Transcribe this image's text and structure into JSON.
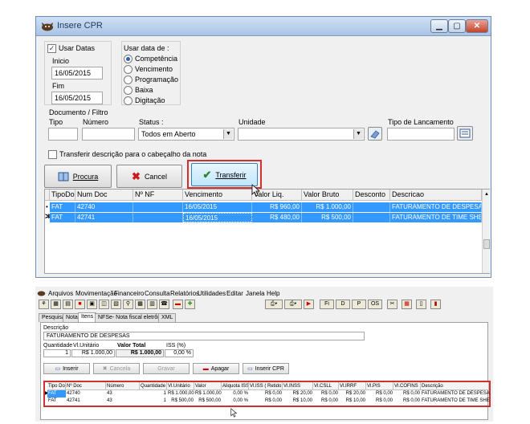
{
  "dialog": {
    "title": "Insere CPR",
    "usar_datas_label": "Usar Datas",
    "inicio_label": "Inicio",
    "inicio_value": "16/05/2015",
    "fim_label": "Fim",
    "fim_value": "16/05/2015",
    "usar_data_de_label": "Usar data de :",
    "radio_options": [
      "Competência",
      "Vencimento",
      "Programação",
      "Baixa",
      "Digitação"
    ],
    "documento_filtro_label": "Documento / Filtro",
    "tipo_label": "Tipo",
    "numero_label": "Número",
    "status_label": "Status :",
    "status_value": "Todos em Aberto",
    "unidade_label": "Unidade",
    "tipo_lancamento_label": "Tipo de Lancamento",
    "transferir_desc_label": "Transferir descrição para o cabeçalho da nota",
    "buttons": {
      "procura": "Procura",
      "cancel": "Cancel",
      "transferir": "Transferir"
    },
    "grid": {
      "headers": [
        "TipoDoc",
        "Num Doc",
        "Nº NF",
        "Vencimento",
        "Valor Liq.",
        "Valor Bruto",
        "Desconto",
        "Descricao"
      ],
      "rows": [
        [
          "FAT",
          "42740",
          "",
          "16/05/2015",
          "R$ 960,00",
          "R$ 1.000,00",
          "",
          "FATURAMENTO DE DESPESAS"
        ],
        [
          "FAT",
          "42741",
          "",
          "16/05/2015",
          "R$ 480,00",
          "R$ 500,00",
          "",
          "FATURAMENTO DE TIME SHEET"
        ]
      ]
    }
  },
  "app": {
    "menu": [
      "Arquivos",
      "Movimentação",
      "Financeiro",
      "Consulta",
      "Relatórios",
      "Utilidades",
      "Editar",
      "Janela",
      "Help"
    ],
    "tabs": [
      "Pesquisa",
      "Nota",
      "Itens",
      "NFSe- Nota fiscal eletrônica",
      "XML"
    ],
    "toolbar_labels": [
      "Fi",
      "D",
      "P",
      "OS"
    ],
    "descricao_label": "Descrição",
    "descricao_value": "FATURAMENTO DE DESPESAS",
    "quantidade_label": "Quantidade",
    "vl_unitario_label": "Vl.Unitário",
    "valor_total_label": "Valor Total",
    "iss_label": "ISS (%)",
    "quantidade_value": "1",
    "vl_unitario_value": "R$ 1.000,00",
    "valor_total_value": "R$ 1.000,00",
    "iss_value": "0,00 %",
    "buttons": {
      "inserir": "Inserir",
      "cancela": "Cancela",
      "gravar": "Gravar",
      "apagar": "Apagar",
      "inserir_cpr": "Inserir CPR"
    },
    "grid": {
      "headers": [
        "Tipo Doc",
        "Nº Doc",
        "Número",
        "Quantidade",
        "Vl.Unitário",
        "Valor",
        "Aliquota ISS",
        "Vl.ISS ( Retido )",
        "Vl.INSS",
        "Vl.CSLL",
        "Vl.IRRF",
        "Vl.PIS",
        "Vl.COFINS",
        "Descrição"
      ],
      "rows": [
        [
          "FAT",
          "42740",
          "43",
          "1",
          "R$ 1.000,00",
          "R$ 1.000,00",
          "0,00 %",
          "R$ 0,00",
          "R$ 20,00",
          "R$ 0,00",
          "R$ 20,00",
          "R$ 0,00",
          "R$ 0,00",
          "FATURAMENTO DE DESPESAS"
        ],
        [
          "FAT",
          "42741",
          "43",
          "1",
          "R$ 500,00",
          "R$ 500,00",
          "0,00 %",
          "R$ 0,00",
          "R$ 10,00",
          "R$ 0,00",
          "R$ 10,00",
          "R$ 0,00",
          "R$ 0,00",
          "FATURAMENTO DE TIME SHEET"
        ]
      ]
    }
  },
  "colors": {
    "selection": "#3399ff",
    "highlight_border": "#d23030"
  }
}
